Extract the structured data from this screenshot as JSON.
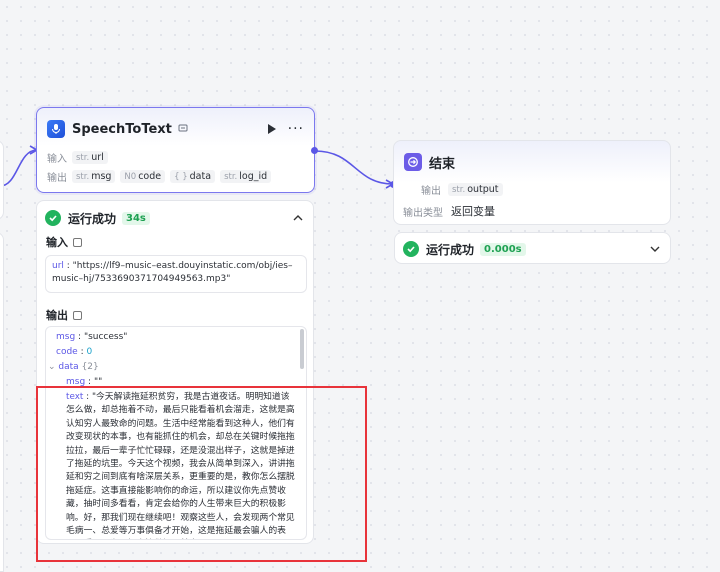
{
  "stt_node": {
    "title": "SpeechToText",
    "input_label": "输入",
    "output_label": "输出",
    "inputs": [
      {
        "type": "str.",
        "name": "url"
      }
    ],
    "outputs": [
      {
        "type": "str.",
        "name": "msg"
      },
      {
        "type": "N0",
        "name": "code"
      },
      {
        "type": "{ }",
        "name": "data"
      },
      {
        "type": "str.",
        "name": "log_id"
      }
    ]
  },
  "stt_result": {
    "status": "运行成功",
    "duration": "34s",
    "input_title": "输入",
    "input_url_key": "url",
    "input_url_value": "\"https://lf9–music–east.douyinstatic.com/obj/ies–music–hj/7533690371704949563.mp3\"",
    "output_title": "输出",
    "msg_key": "msg",
    "msg_value": "\"success\"",
    "code_key": "code",
    "code_value": "0",
    "data_key": "data",
    "data_count": "{2}",
    "data_msg_key": "msg",
    "data_msg_value": "\"\"",
    "text_key": "text",
    "text_value": "\"今天解读拖延积贫穷，我是古道夜话。明明知道该怎么做，却总拖着不动，最后只能看着机会溜走，这就是高认知穷人最致命的问题。生活中经常能看到这种人，他们有改变现状的本事，也有能抓住的机会，却总在关键时候拖拖拉拉，最后一辈子忙忙碌碌，还是没混出样子，这就是掉进了拖延的坑里。今天这个视频，我会从简单到深入，讲讲拖延和穷之间到底有啥深层关系，更重要的是，教你怎么摆脱拖延症。这事直接能影响你的命运，所以建议你先点赞收藏，抽时间多看看，肯定会给你的人生带来巨大的积极影响。好，那我们现在继续吧！观察这些人，会发现两个常见毛病一、总爱等万事俱备才开始，这是拖延最会骗人的表现。看似是为了把事情做好，其实是"
  },
  "end_node": {
    "title": "结束",
    "output_label": "输出",
    "output_type": "str.",
    "output_name": "output",
    "output_type_label": "输出类型",
    "output_type_value": "返回变量"
  },
  "end_result": {
    "status": "运行成功",
    "duration": "0.000s"
  },
  "colors": {
    "accent": "#5b57e6",
    "success": "#22b35e",
    "highlight": "#e8333a"
  }
}
